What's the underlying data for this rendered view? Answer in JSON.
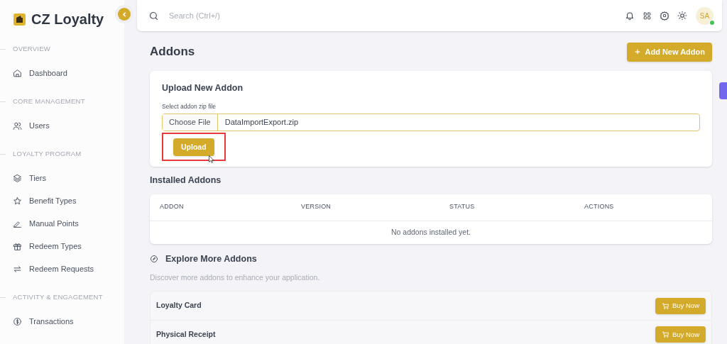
{
  "brand": {
    "name": "CZ Loyalty"
  },
  "sidebar": {
    "sections": [
      {
        "heading": "OVERVIEW",
        "items": [
          {
            "label": "Dashboard"
          }
        ]
      },
      {
        "heading": "CORE MANAGEMENT",
        "items": [
          {
            "label": "Users"
          }
        ]
      },
      {
        "heading": "LOYALTY PROGRAM",
        "items": [
          {
            "label": "Tiers"
          },
          {
            "label": "Benefit Types"
          },
          {
            "label": "Manual Points"
          },
          {
            "label": "Redeem Types"
          },
          {
            "label": "Redeem Requests"
          }
        ]
      },
      {
        "heading": "ACTIVITY & ENGAGEMENT",
        "items": [
          {
            "label": "Transactions"
          }
        ]
      }
    ]
  },
  "topbar": {
    "search": {
      "placeholder": "Search (Ctrl+/)"
    },
    "avatar": "SA",
    "online": true
  },
  "page": {
    "title": "Addons",
    "add_button": "Add New Addon"
  },
  "upload": {
    "title": "Upload New Addon",
    "field_label": "Select addon zip file",
    "choose_button": "Choose File",
    "file_name": "DataImportExport.zip",
    "upload_button": "Upload",
    "highlighted": true
  },
  "installed": {
    "title": "Installed Addons",
    "columns": [
      "ADDON",
      "VERSION",
      "STATUS",
      "ACTIONS"
    ],
    "empty": "No addons installed yet."
  },
  "explore": {
    "title": "Explore More Addons",
    "subtitle": "Discover more addons to enhance your application.",
    "items": [
      {
        "name": "Loyalty Card",
        "button": "Buy Now"
      },
      {
        "name": "Physical Receipt",
        "button": "Buy Now"
      }
    ]
  }
}
